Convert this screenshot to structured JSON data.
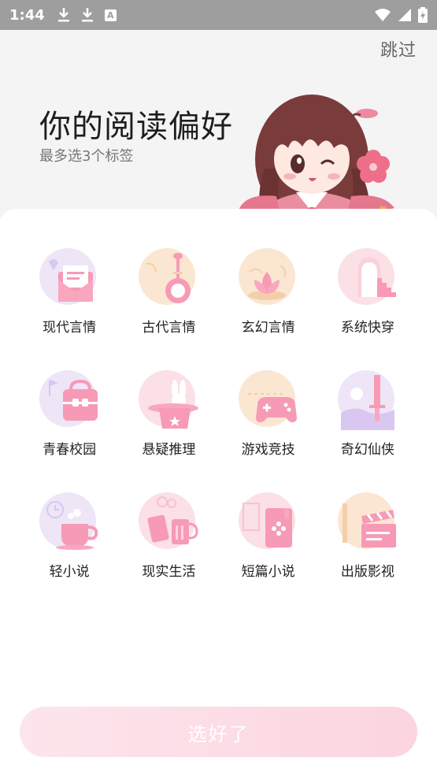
{
  "status_bar": {
    "time": "1:44",
    "icons": [
      "download-icon",
      "download-icon",
      "text-a-icon"
    ],
    "right_icons": [
      "wifi-icon",
      "signal-icon",
      "battery-icon"
    ],
    "a_label": "A"
  },
  "header": {
    "skip_label": "跳过",
    "title": "你的阅读偏好",
    "subtitle": "最多选3个标签"
  },
  "genres": [
    {
      "label": "现代言情",
      "icon": "envelope-heart-icon"
    },
    {
      "label": "古代言情",
      "icon": "pipa-instrument-icon"
    },
    {
      "label": "玄幻言情",
      "icon": "lotus-icon"
    },
    {
      "label": "系统快穿",
      "icon": "portal-door-icon"
    },
    {
      "label": "青春校园",
      "icon": "school-bag-icon"
    },
    {
      "label": "悬疑推理",
      "icon": "magic-hat-rabbit-icon"
    },
    {
      "label": "游戏竞技",
      "icon": "gamepad-icon"
    },
    {
      "label": "奇幻仙侠",
      "icon": "sword-icon"
    },
    {
      "label": "轻小说",
      "icon": "tea-cup-icon"
    },
    {
      "label": "现实生活",
      "icon": "beer-mugs-icon"
    },
    {
      "label": "短篇小说",
      "icon": "book-icon"
    },
    {
      "label": "出版影视",
      "icon": "clapperboard-icon"
    }
  ],
  "confirm_label": "选好了",
  "colors": {
    "accent_pink": "#f79ab6",
    "header_bg": "#f4f4f4",
    "status_bg": "#9e9e9e",
    "button_from": "#fde5ec",
    "button_to": "#fbd5e0"
  }
}
